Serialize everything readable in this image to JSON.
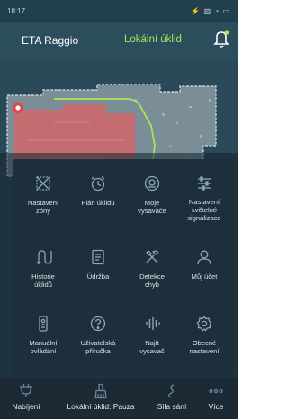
{
  "status": {
    "time": "18:17",
    "icons": "… ⚡ ▥ ◔ ▭"
  },
  "header": {
    "device": "ETA Raggio",
    "mode": "Lokální úklid"
  },
  "menu": [
    {
      "label": "Nastavení\nzóny",
      "icon": "zone-icon"
    },
    {
      "label": "Plán úklidu",
      "icon": "alarm-clock-icon"
    },
    {
      "label": "Moje\nvysavače",
      "icon": "robot-vacuum-icon"
    },
    {
      "label": "Nastavení\nsvětelné\nsignalizace",
      "icon": "sliders-icon"
    },
    {
      "label": "Historie\núklidů",
      "icon": "history-icon"
    },
    {
      "label": "Údržba",
      "icon": "document-icon"
    },
    {
      "label": "Detekce\nchyb",
      "icon": "tools-icon"
    },
    {
      "label": "Můj účet",
      "icon": "user-icon"
    },
    {
      "label": "Manuální\novládání",
      "icon": "remote-icon"
    },
    {
      "label": "Uživatelská\npříručka",
      "icon": "help-icon"
    },
    {
      "label": "Najít\nvysavač",
      "icon": "signal-icon"
    },
    {
      "label": "Obecné\nnastavení",
      "icon": "settings-icon"
    }
  ],
  "tabs": [
    {
      "label": "Nabíjení",
      "icon": "charging-icon"
    },
    {
      "label": "Lokální úklid: Pauza",
      "icon": "brush-icon"
    },
    {
      "label": "Síla sání",
      "icon": "suction-icon"
    },
    {
      "label": "Více",
      "icon": "more-icon"
    }
  ],
  "colors": {
    "accent": "#a8e55a",
    "room": "#c96a6e",
    "background": "#1f3341"
  }
}
